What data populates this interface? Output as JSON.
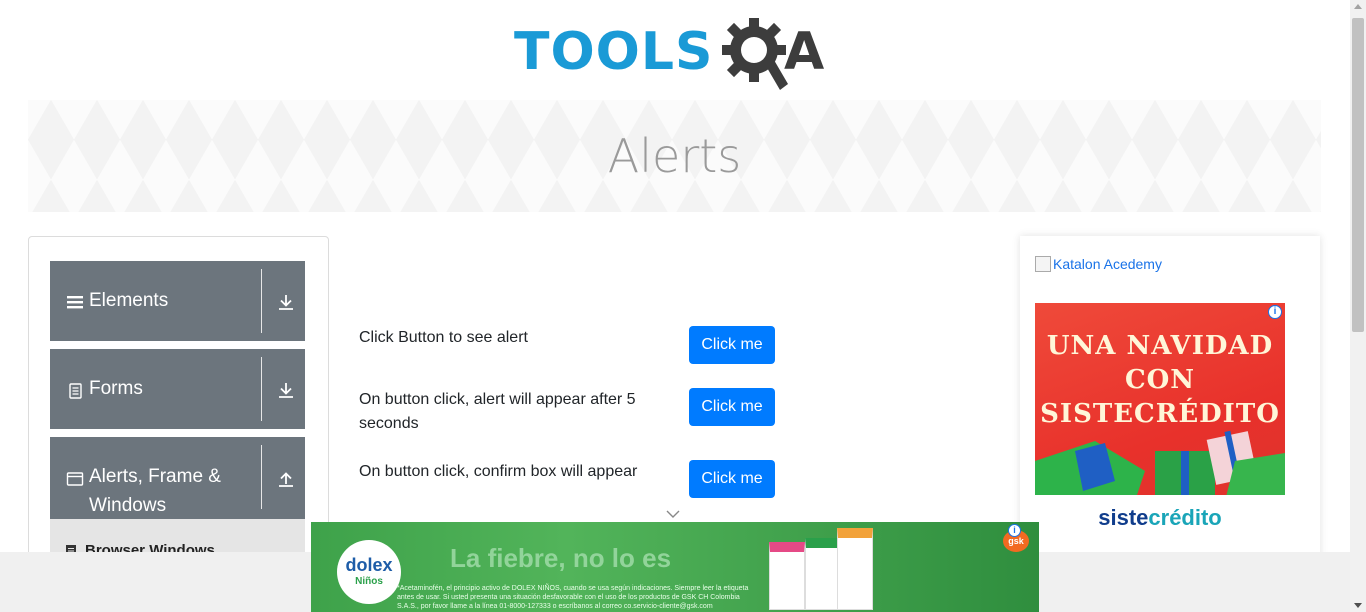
{
  "header": {
    "logo_part1": "TOOLS",
    "logo_part2": "A",
    "logo_colors": {
      "tools": "#1a9ad6",
      "qa": "#3d3d3d"
    }
  },
  "banner": {
    "title": "Alerts"
  },
  "sidebar": {
    "groups": [
      {
        "label": "Elements",
        "icon": "menu-icon",
        "arrow": "download-arrow-icon"
      },
      {
        "label": "Forms",
        "icon": "document-icon",
        "arrow": "download-arrow-icon"
      },
      {
        "label": "Alerts, Frame &",
        "label2": "Windows",
        "icon": "window-icon",
        "arrow": "upload-arrow-icon"
      }
    ],
    "subitems": [
      {
        "label": "Browser Windows",
        "icon": "document-icon"
      }
    ],
    "group_color": "#6c757d"
  },
  "main": {
    "rows": [
      {
        "text": "Click Button to see alert",
        "button": "Click me"
      },
      {
        "text": "On button click, alert will appear after 5 seconds",
        "button": "Click me"
      },
      {
        "text": "On button click, confirm box will appear",
        "button": "Click me"
      }
    ],
    "button_color": "#007bff"
  },
  "ads": {
    "katalon_alt": "Katalon Acedemy",
    "sistecredito": {
      "headline": "UNA NAVIDAD CON SISTECRÉDITO",
      "brand_part1": "siste",
      "brand_part2": "crédito",
      "info": "i"
    },
    "dolex": {
      "brand": "dolex",
      "brand_sub": "Niños",
      "tagline": "La fiebre, no lo es",
      "fine_print": "*Acetaminofén, el principio activo de DOLEX NIÑOS, cuando se usa según indicaciones. Siempre leer la etiqueta antes de usar. Si usted presenta una situación desfavorable con el uso de los productos de GSK CH Colombia S.A.S., por favor llame a la línea 01-8000-127333 o escríbanos al correo co.servicio-cliente@gsk.com",
      "gsk": "gsk",
      "info": "i"
    }
  }
}
